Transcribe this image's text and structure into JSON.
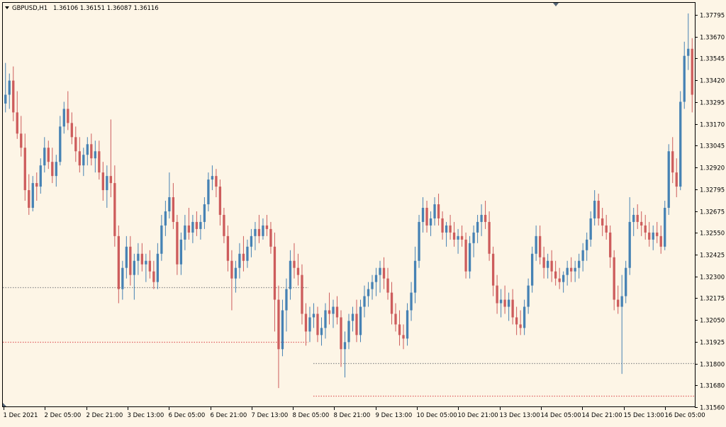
{
  "colors": {
    "background": "#fdf5e6",
    "frame": "#000000",
    "bull": "#4682b4",
    "bear": "#cd5c5c",
    "level_gray": "#8c8c8c",
    "level_red": "#e06060"
  },
  "header": {
    "menu_icon": "triangle-down-icon",
    "symbol": "GBPUSD,H1",
    "ohlc": "1.36106 1.36151 1.36087 1.36116"
  },
  "chart_data": {
    "type": "candlestick",
    "symbol": "GBPUSD",
    "timeframe": "H1",
    "y_ticks": [
      "1.37795",
      "1.33670",
      "1.33545",
      "1.33420",
      "1.33295",
      "1.33170",
      "1.33045",
      "1.32920",
      "1.32795",
      "1.32675",
      "1.32550",
      "1.32425",
      "1.32300",
      "1.32175",
      "1.32050",
      "1.31925",
      "1.31800",
      "1.31680",
      "1.31560"
    ],
    "ylim": [
      1.3154,
      1.3382
    ],
    "x_ticks": [
      "1 Dec 2021",
      "2 Dec 05:00",
      "2 Dec 21:00",
      "3 Dec 13:00",
      "6 Dec 05:00",
      "6 Dec 21:00",
      "7 Dec 13:00",
      "8 Dec 05:00",
      "8 Dec 21:00",
      "9 Dec 13:00",
      "10 Dec 05:00",
      "10 Dec 21:00",
      "13 Dec 13:00",
      "14 Dec 05:00",
      "14 Dec 21:00",
      "15 Dec 13:00",
      "16 Dec 05:00"
    ],
    "levels": [
      {
        "price": 1.3221,
        "color": "gray",
        "from": 0,
        "to": 435
      },
      {
        "price": 1.319,
        "color": "red",
        "from": 0,
        "to": 435
      },
      {
        "price": 1.3178,
        "color": "gray",
        "from": 438,
        "to": 980
      },
      {
        "price": 1.31595,
        "color": "red",
        "from": 438,
        "to": 980
      }
    ],
    "candles": [
      [
        1.3325,
        1.3348,
        1.332,
        1.333
      ],
      [
        1.333,
        1.3342,
        1.3322,
        1.3338
      ],
      [
        1.3338,
        1.3346,
        1.3315,
        1.332
      ],
      [
        1.332,
        1.3332,
        1.3305,
        1.3308
      ],
      [
        1.3308,
        1.3318,
        1.3295,
        1.33
      ],
      [
        1.33,
        1.3308,
        1.327,
        1.3276
      ],
      [
        1.3276,
        1.3285,
        1.3262,
        1.3266
      ],
      [
        1.3266,
        1.3284,
        1.3264,
        1.328
      ],
      [
        1.328,
        1.3286,
        1.327,
        1.3278
      ],
      [
        1.3278,
        1.3294,
        1.3274,
        1.329
      ],
      [
        1.329,
        1.3306,
        1.3286,
        1.33
      ],
      [
        1.33,
        1.3304,
        1.3288,
        1.3292
      ],
      [
        1.3292,
        1.33,
        1.328,
        1.3284
      ],
      [
        1.3284,
        1.3296,
        1.3278,
        1.3292
      ],
      [
        1.3292,
        1.3318,
        1.329,
        1.3312
      ],
      [
        1.3312,
        1.3326,
        1.3308,
        1.3322
      ],
      [
        1.3322,
        1.3332,
        1.331,
        1.3314
      ],
      [
        1.3314,
        1.332,
        1.3302,
        1.3306
      ],
      [
        1.3306,
        1.3312,
        1.3292,
        1.3298
      ],
      [
        1.3298,
        1.3306,
        1.3286,
        1.329
      ],
      [
        1.329,
        1.33,
        1.3284,
        1.3296
      ],
      [
        1.3296,
        1.3306,
        1.329,
        1.3302
      ],
      [
        1.3302,
        1.3308,
        1.329,
        1.3294
      ],
      [
        1.3294,
        1.3304,
        1.3286,
        1.3298
      ],
      [
        1.3298,
        1.3304,
        1.3282,
        1.3286
      ],
      [
        1.3286,
        1.3292,
        1.327,
        1.3276
      ],
      [
        1.3276,
        1.329,
        1.3266,
        1.3284
      ],
      [
        1.3284,
        1.3316,
        1.3272,
        1.328
      ],
      [
        1.328,
        1.329,
        1.3244,
        1.325
      ],
      [
        1.325,
        1.3256,
        1.3212,
        1.322
      ],
      [
        1.322,
        1.3236,
        1.3214,
        1.3232
      ],
      [
        1.3232,
        1.325,
        1.3226,
        1.3244
      ],
      [
        1.3244,
        1.325,
        1.3222,
        1.3228
      ],
      [
        1.3228,
        1.324,
        1.3214,
        1.3236
      ],
      [
        1.3236,
        1.3246,
        1.3228,
        1.324
      ],
      [
        1.324,
        1.3246,
        1.323,
        1.3234
      ],
      [
        1.3234,
        1.324,
        1.3224,
        1.3236
      ],
      [
        1.3236,
        1.3242,
        1.3226,
        1.323
      ],
      [
        1.323,
        1.3236,
        1.322,
        1.3224
      ],
      [
        1.3224,
        1.3246,
        1.322,
        1.324
      ],
      [
        1.324,
        1.3262,
        1.3236,
        1.3256
      ],
      [
        1.3256,
        1.327,
        1.325,
        1.3264
      ],
      [
        1.3264,
        1.3286,
        1.326,
        1.3272
      ],
      [
        1.3272,
        1.328,
        1.3254,
        1.3258
      ],
      [
        1.3258,
        1.3262,
        1.3228,
        1.3234
      ],
      [
        1.3234,
        1.3252,
        1.3228,
        1.3248
      ],
      [
        1.3248,
        1.3262,
        1.3242,
        1.3256
      ],
      [
        1.3256,
        1.3266,
        1.3248,
        1.3252
      ],
      [
        1.3252,
        1.3262,
        1.3246,
        1.3258
      ],
      [
        1.3258,
        1.3264,
        1.325,
        1.3254
      ],
      [
        1.3254,
        1.3262,
        1.3248,
        1.3258
      ],
      [
        1.3258,
        1.3272,
        1.3254,
        1.3268
      ],
      [
        1.3268,
        1.3286,
        1.3264,
        1.3282
      ],
      [
        1.3282,
        1.329,
        1.3276,
        1.3284
      ],
      [
        1.3284,
        1.3288,
        1.3272,
        1.3278
      ],
      [
        1.3278,
        1.3282,
        1.3256,
        1.3262
      ],
      [
        1.3262,
        1.3266,
        1.3246,
        1.325
      ],
      [
        1.325,
        1.3256,
        1.323,
        1.3236
      ],
      [
        1.3236,
        1.3242,
        1.3208,
        1.3226
      ],
      [
        1.3226,
        1.3236,
        1.3218,
        1.3232
      ],
      [
        1.3232,
        1.3246,
        1.3226,
        1.324
      ],
      [
        1.324,
        1.325,
        1.323,
        1.3236
      ],
      [
        1.3236,
        1.3248,
        1.3232,
        1.3244
      ],
      [
        1.3244,
        1.3254,
        1.3238,
        1.325
      ],
      [
        1.325,
        1.3258,
        1.3242,
        1.3254
      ],
      [
        1.3254,
        1.3262,
        1.3246,
        1.325
      ],
      [
        1.325,
        1.326,
        1.3248,
        1.3256
      ],
      [
        1.3256,
        1.3262,
        1.325,
        1.3254
      ],
      [
        1.3254,
        1.3258,
        1.324,
        1.3244
      ],
      [
        1.3244,
        1.3252,
        1.3196,
        1.3214
      ],
      [
        1.3214,
        1.3222,
        1.3164,
        1.3186
      ],
      [
        1.3186,
        1.3214,
        1.3182,
        1.3208
      ],
      [
        1.3208,
        1.3226,
        1.3196,
        1.322
      ],
      [
        1.322,
        1.3242,
        1.3214,
        1.3236
      ],
      [
        1.3236,
        1.3246,
        1.3226,
        1.3232
      ],
      [
        1.3232,
        1.324,
        1.3222,
        1.3228
      ],
      [
        1.3228,
        1.3234,
        1.32,
        1.3206
      ],
      [
        1.3206,
        1.3212,
        1.3188,
        1.3196
      ],
      [
        1.3196,
        1.321,
        1.319,
        1.3204
      ],
      [
        1.3204,
        1.3212,
        1.3198,
        1.3206
      ],
      [
        1.3206,
        1.321,
        1.319,
        1.3194
      ],
      [
        1.3194,
        1.3204,
        1.3188,
        1.3198
      ],
      [
        1.3198,
        1.3212,
        1.3192,
        1.3208
      ],
      [
        1.3208,
        1.3218,
        1.32,
        1.3206
      ],
      [
        1.3206,
        1.3214,
        1.3198,
        1.321
      ],
      [
        1.321,
        1.3216,
        1.32,
        1.3204
      ],
      [
        1.3204,
        1.3208,
        1.3176,
        1.3186
      ],
      [
        1.3186,
        1.3196,
        1.317,
        1.319
      ],
      [
        1.319,
        1.3206,
        1.3186,
        1.3202
      ],
      [
        1.3202,
        1.321,
        1.3196,
        1.3206
      ],
      [
        1.3206,
        1.3214,
        1.319,
        1.3194
      ],
      [
        1.3194,
        1.3214,
        1.319,
        1.321
      ],
      [
        1.321,
        1.3222,
        1.3204,
        1.3216
      ],
      [
        1.3216,
        1.3224,
        1.321,
        1.322
      ],
      [
        1.322,
        1.3228,
        1.3214,
        1.3224
      ],
      [
        1.3224,
        1.3232,
        1.3216,
        1.3228
      ],
      [
        1.3228,
        1.3236,
        1.3218,
        1.3232
      ],
      [
        1.3232,
        1.3238,
        1.322,
        1.3226
      ],
      [
        1.3226,
        1.3232,
        1.3214,
        1.3218
      ],
      [
        1.3218,
        1.3224,
        1.32,
        1.3206
      ],
      [
        1.3206,
        1.3212,
        1.3196,
        1.32
      ],
      [
        1.32,
        1.3208,
        1.3188,
        1.3194
      ],
      [
        1.3194,
        1.32,
        1.3186,
        1.3192
      ],
      [
        1.3192,
        1.3212,
        1.3188,
        1.3208
      ],
      [
        1.3208,
        1.3224,
        1.3202,
        1.3218
      ],
      [
        1.3218,
        1.3244,
        1.3212,
        1.3236
      ],
      [
        1.3236,
        1.3262,
        1.3232,
        1.3258
      ],
      [
        1.3258,
        1.3272,
        1.3252,
        1.3266
      ],
      [
        1.3266,
        1.327,
        1.3252,
        1.3256
      ],
      [
        1.3256,
        1.3264,
        1.325,
        1.326
      ],
      [
        1.326,
        1.3272,
        1.3256,
        1.3268
      ],
      [
        1.3268,
        1.3274,
        1.3256,
        1.326
      ],
      [
        1.326,
        1.3264,
        1.3248,
        1.3252
      ],
      [
        1.3252,
        1.3258,
        1.3244,
        1.3256
      ],
      [
        1.3256,
        1.3262,
        1.3248,
        1.3252
      ],
      [
        1.3252,
        1.3258,
        1.3244,
        1.3248
      ],
      [
        1.3248,
        1.3254,
        1.324,
        1.325
      ],
      [
        1.325,
        1.3256,
        1.3244,
        1.3248
      ],
      [
        1.3248,
        1.3252,
        1.3226,
        1.323
      ],
      [
        1.323,
        1.325,
        1.3226,
        1.3246
      ],
      [
        1.3246,
        1.3256,
        1.3238,
        1.3252
      ],
      [
        1.3252,
        1.3262,
        1.3246,
        1.3258
      ],
      [
        1.3258,
        1.3268,
        1.325,
        1.3262
      ],
      [
        1.3262,
        1.327,
        1.3254,
        1.3258
      ],
      [
        1.3258,
        1.3264,
        1.3236,
        1.324
      ],
      [
        1.324,
        1.3244,
        1.3216,
        1.3222
      ],
      [
        1.3222,
        1.3228,
        1.3206,
        1.3212
      ],
      [
        1.3212,
        1.322,
        1.3204,
        1.3214
      ],
      [
        1.3214,
        1.3222,
        1.3206,
        1.321
      ],
      [
        1.321,
        1.3218,
        1.3202,
        1.3214
      ],
      [
        1.3214,
        1.322,
        1.32,
        1.3204
      ],
      [
        1.3204,
        1.321,
        1.3194,
        1.32
      ],
      [
        1.32,
        1.3208,
        1.3194,
        1.3198
      ],
      [
        1.3198,
        1.3214,
        1.3194,
        1.321
      ],
      [
        1.321,
        1.3226,
        1.3206,
        1.3222
      ],
      [
        1.3222,
        1.3244,
        1.3218,
        1.324
      ],
      [
        1.324,
        1.3256,
        1.3236,
        1.325
      ],
      [
        1.325,
        1.3256,
        1.3234,
        1.3238
      ],
      [
        1.3238,
        1.3244,
        1.3226,
        1.3232
      ],
      [
        1.3232,
        1.324,
        1.3226,
        1.3236
      ],
      [
        1.3236,
        1.3242,
        1.3224,
        1.323
      ],
      [
        1.323,
        1.3236,
        1.3222,
        1.3226
      ],
      [
        1.3226,
        1.3232,
        1.322,
        1.3224
      ],
      [
        1.3224,
        1.323,
        1.3218,
        1.3228
      ],
      [
        1.3228,
        1.3236,
        1.3222,
        1.3232
      ],
      [
        1.3232,
        1.3238,
        1.3224,
        1.323
      ],
      [
        1.323,
        1.3236,
        1.3224,
        1.3232
      ],
      [
        1.3232,
        1.324,
        1.3226,
        1.3236
      ],
      [
        1.3236,
        1.3246,
        1.323,
        1.3242
      ],
      [
        1.3242,
        1.3252,
        1.3236,
        1.3248
      ],
      [
        1.3248,
        1.3264,
        1.3244,
        1.326
      ],
      [
        1.326,
        1.3276,
        1.3256,
        1.327
      ],
      [
        1.327,
        1.3274,
        1.3256,
        1.326
      ],
      [
        1.326,
        1.3266,
        1.325,
        1.3256
      ],
      [
        1.3256,
        1.3262,
        1.3248,
        1.3252
      ],
      [
        1.3252,
        1.3256,
        1.3232,
        1.3238
      ],
      [
        1.3238,
        1.3242,
        1.3208,
        1.3214
      ],
      [
        1.3214,
        1.3222,
        1.3206,
        1.321
      ],
      [
        1.321,
        1.3228,
        1.3172,
        1.3216
      ],
      [
        1.3216,
        1.3236,
        1.3212,
        1.3232
      ],
      [
        1.3232,
        1.3272,
        1.3228,
        1.3258
      ],
      [
        1.3258,
        1.3266,
        1.325,
        1.3262
      ],
      [
        1.3262,
        1.3268,
        1.3254,
        1.3258
      ],
      [
        1.3258,
        1.3264,
        1.325,
        1.3256
      ],
      [
        1.3256,
        1.3262,
        1.3248,
        1.3252
      ],
      [
        1.3252,
        1.3258,
        1.3244,
        1.3248
      ],
      [
        1.3248,
        1.3256,
        1.3242,
        1.3252
      ],
      [
        1.3252,
        1.3258,
        1.3246,
        1.325
      ],
      [
        1.325,
        1.3256,
        1.324,
        1.3244
      ],
      [
        1.3244,
        1.327,
        1.3242,
        1.3266
      ],
      [
        1.3266,
        1.3302,
        1.3262,
        1.3298
      ],
      [
        1.3298,
        1.3306,
        1.328,
        1.3286
      ],
      [
        1.3286,
        1.3294,
        1.3272,
        1.3278
      ],
      [
        1.3278,
        1.3332,
        1.3276,
        1.3326
      ],
      [
        1.3326,
        1.336,
        1.3322,
        1.3352
      ],
      [
        1.3352,
        1.3376,
        1.3344,
        1.3356
      ],
      [
        1.3356,
        1.3362,
        1.332,
        1.333
      ]
    ]
  }
}
